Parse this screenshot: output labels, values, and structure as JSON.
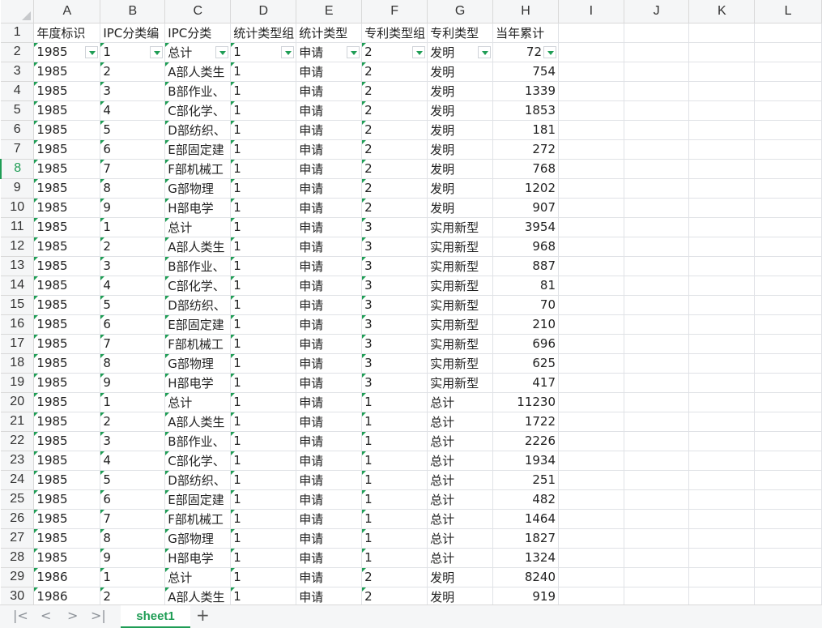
{
  "columns": [
    "A",
    "B",
    "C",
    "D",
    "E",
    "F",
    "G",
    "H",
    "I",
    "J",
    "K",
    "L"
  ],
  "header_row": [
    "年度标识",
    "IPC分类编",
    "IPC分类",
    "统计类型组",
    "统计类型",
    "专利类型组",
    "专利类型",
    "当年累计"
  ],
  "rows": [
    [
      "1985",
      "1",
      "总计",
      "1",
      "申请",
      "2",
      "发明",
      "72"
    ],
    [
      "1985",
      "2",
      "A部人类生",
      "1",
      "申请",
      "2",
      "发明",
      "754"
    ],
    [
      "1985",
      "3",
      "B部作业、",
      "1",
      "申请",
      "2",
      "发明",
      "1339"
    ],
    [
      "1985",
      "4",
      "C部化学、",
      "1",
      "申请",
      "2",
      "发明",
      "1853"
    ],
    [
      "1985",
      "5",
      "D部纺织、",
      "1",
      "申请",
      "2",
      "发明",
      "181"
    ],
    [
      "1985",
      "6",
      "E部固定建",
      "1",
      "申请",
      "2",
      "发明",
      "272"
    ],
    [
      "1985",
      "7",
      "F部机械工",
      "1",
      "申请",
      "2",
      "发明",
      "768"
    ],
    [
      "1985",
      "8",
      "G部物理",
      "1",
      "申请",
      "2",
      "发明",
      "1202"
    ],
    [
      "1985",
      "9",
      "H部电学",
      "1",
      "申请",
      "2",
      "发明",
      "907"
    ],
    [
      "1985",
      "1",
      "总计",
      "1",
      "申请",
      "3",
      "实用新型",
      "3954"
    ],
    [
      "1985",
      "2",
      "A部人类生",
      "1",
      "申请",
      "3",
      "实用新型",
      "968"
    ],
    [
      "1985",
      "3",
      "B部作业、",
      "1",
      "申请",
      "3",
      "实用新型",
      "887"
    ],
    [
      "1985",
      "4",
      "C部化学、",
      "1",
      "申请",
      "3",
      "实用新型",
      "81"
    ],
    [
      "1985",
      "5",
      "D部纺织、",
      "1",
      "申请",
      "3",
      "实用新型",
      "70"
    ],
    [
      "1985",
      "6",
      "E部固定建",
      "1",
      "申请",
      "3",
      "实用新型",
      "210"
    ],
    [
      "1985",
      "7",
      "F部机械工",
      "1",
      "申请",
      "3",
      "实用新型",
      "696"
    ],
    [
      "1985",
      "8",
      "G部物理",
      "1",
      "申请",
      "3",
      "实用新型",
      "625"
    ],
    [
      "1985",
      "9",
      "H部电学",
      "1",
      "申请",
      "3",
      "实用新型",
      "417"
    ],
    [
      "1985",
      "1",
      "总计",
      "1",
      "申请",
      "1",
      "总计",
      "11230"
    ],
    [
      "1985",
      "2",
      "A部人类生",
      "1",
      "申请",
      "1",
      "总计",
      "1722"
    ],
    [
      "1985",
      "3",
      "B部作业、",
      "1",
      "申请",
      "1",
      "总计",
      "2226"
    ],
    [
      "1985",
      "4",
      "C部化学、",
      "1",
      "申请",
      "1",
      "总计",
      "1934"
    ],
    [
      "1985",
      "5",
      "D部纺织、",
      "1",
      "申请",
      "1",
      "总计",
      "251"
    ],
    [
      "1985",
      "6",
      "E部固定建",
      "1",
      "申请",
      "1",
      "总计",
      "482"
    ],
    [
      "1985",
      "7",
      "F部机械工",
      "1",
      "申请",
      "1",
      "总计",
      "1464"
    ],
    [
      "1985",
      "8",
      "G部物理",
      "1",
      "申请",
      "1",
      "总计",
      "1827"
    ],
    [
      "1985",
      "9",
      "H部电学",
      "1",
      "申请",
      "1",
      "总计",
      "1324"
    ],
    [
      "1986",
      "1",
      "总计",
      "1",
      "申请",
      "2",
      "发明",
      "8240"
    ],
    [
      "1986",
      "2",
      "A部人类生",
      "1",
      "申请",
      "2",
      "发明",
      "919"
    ]
  ],
  "active_row": 8,
  "sheet_tab": "sheet1",
  "nav_icons": [
    "first-sheet-icon",
    "prev-sheet-icon",
    "next-sheet-icon",
    "last-sheet-icon"
  ],
  "add_sheet_label": "+",
  "accent_color": "#1f9d55"
}
